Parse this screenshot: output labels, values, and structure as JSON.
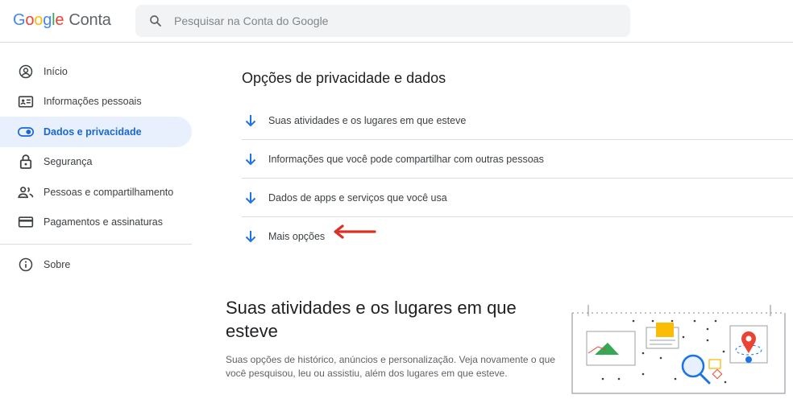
{
  "header": {
    "brand_g": "G",
    "brand_o1": "o",
    "brand_o2": "o",
    "brand_g2": "g",
    "brand_l": "l",
    "brand_e": "e",
    "product": "Conta",
    "search_placeholder": "Pesquisar na Conta do Google"
  },
  "sidebar": {
    "items": [
      {
        "label": "Início",
        "icon": "account-circle-icon"
      },
      {
        "label": "Informações pessoais",
        "icon": "id-card-icon"
      },
      {
        "label": "Dados e privacidade",
        "icon": "toggle-icon",
        "active": true
      },
      {
        "label": "Segurança",
        "icon": "lock-icon"
      },
      {
        "label": "Pessoas e compartilhamento",
        "icon": "people-icon"
      },
      {
        "label": "Pagamentos e assinaturas",
        "icon": "credit-card-icon"
      }
    ],
    "about": {
      "label": "Sobre",
      "icon": "info-icon"
    }
  },
  "main": {
    "section_title": "Opções de privacidade e dados",
    "options": [
      {
        "label": "Suas atividades e os lugares em que esteve"
      },
      {
        "label": "Informações que você pode compartilhar com outras pessoas"
      },
      {
        "label": "Dados de apps e serviços que você usa"
      },
      {
        "label": "Mais opções"
      }
    ],
    "activity_title": "Suas atividades e os lugares em que esteve",
    "activity_desc": "Suas opções de histórico, anúncios e personalização. Veja novamente o que você pesquisou, leu ou assistiu, além dos lugares em que esteve."
  },
  "colors": {
    "accent_blue": "#1a73e8",
    "active_bg": "#e8f0fe",
    "annotation_red": "#d93025"
  }
}
